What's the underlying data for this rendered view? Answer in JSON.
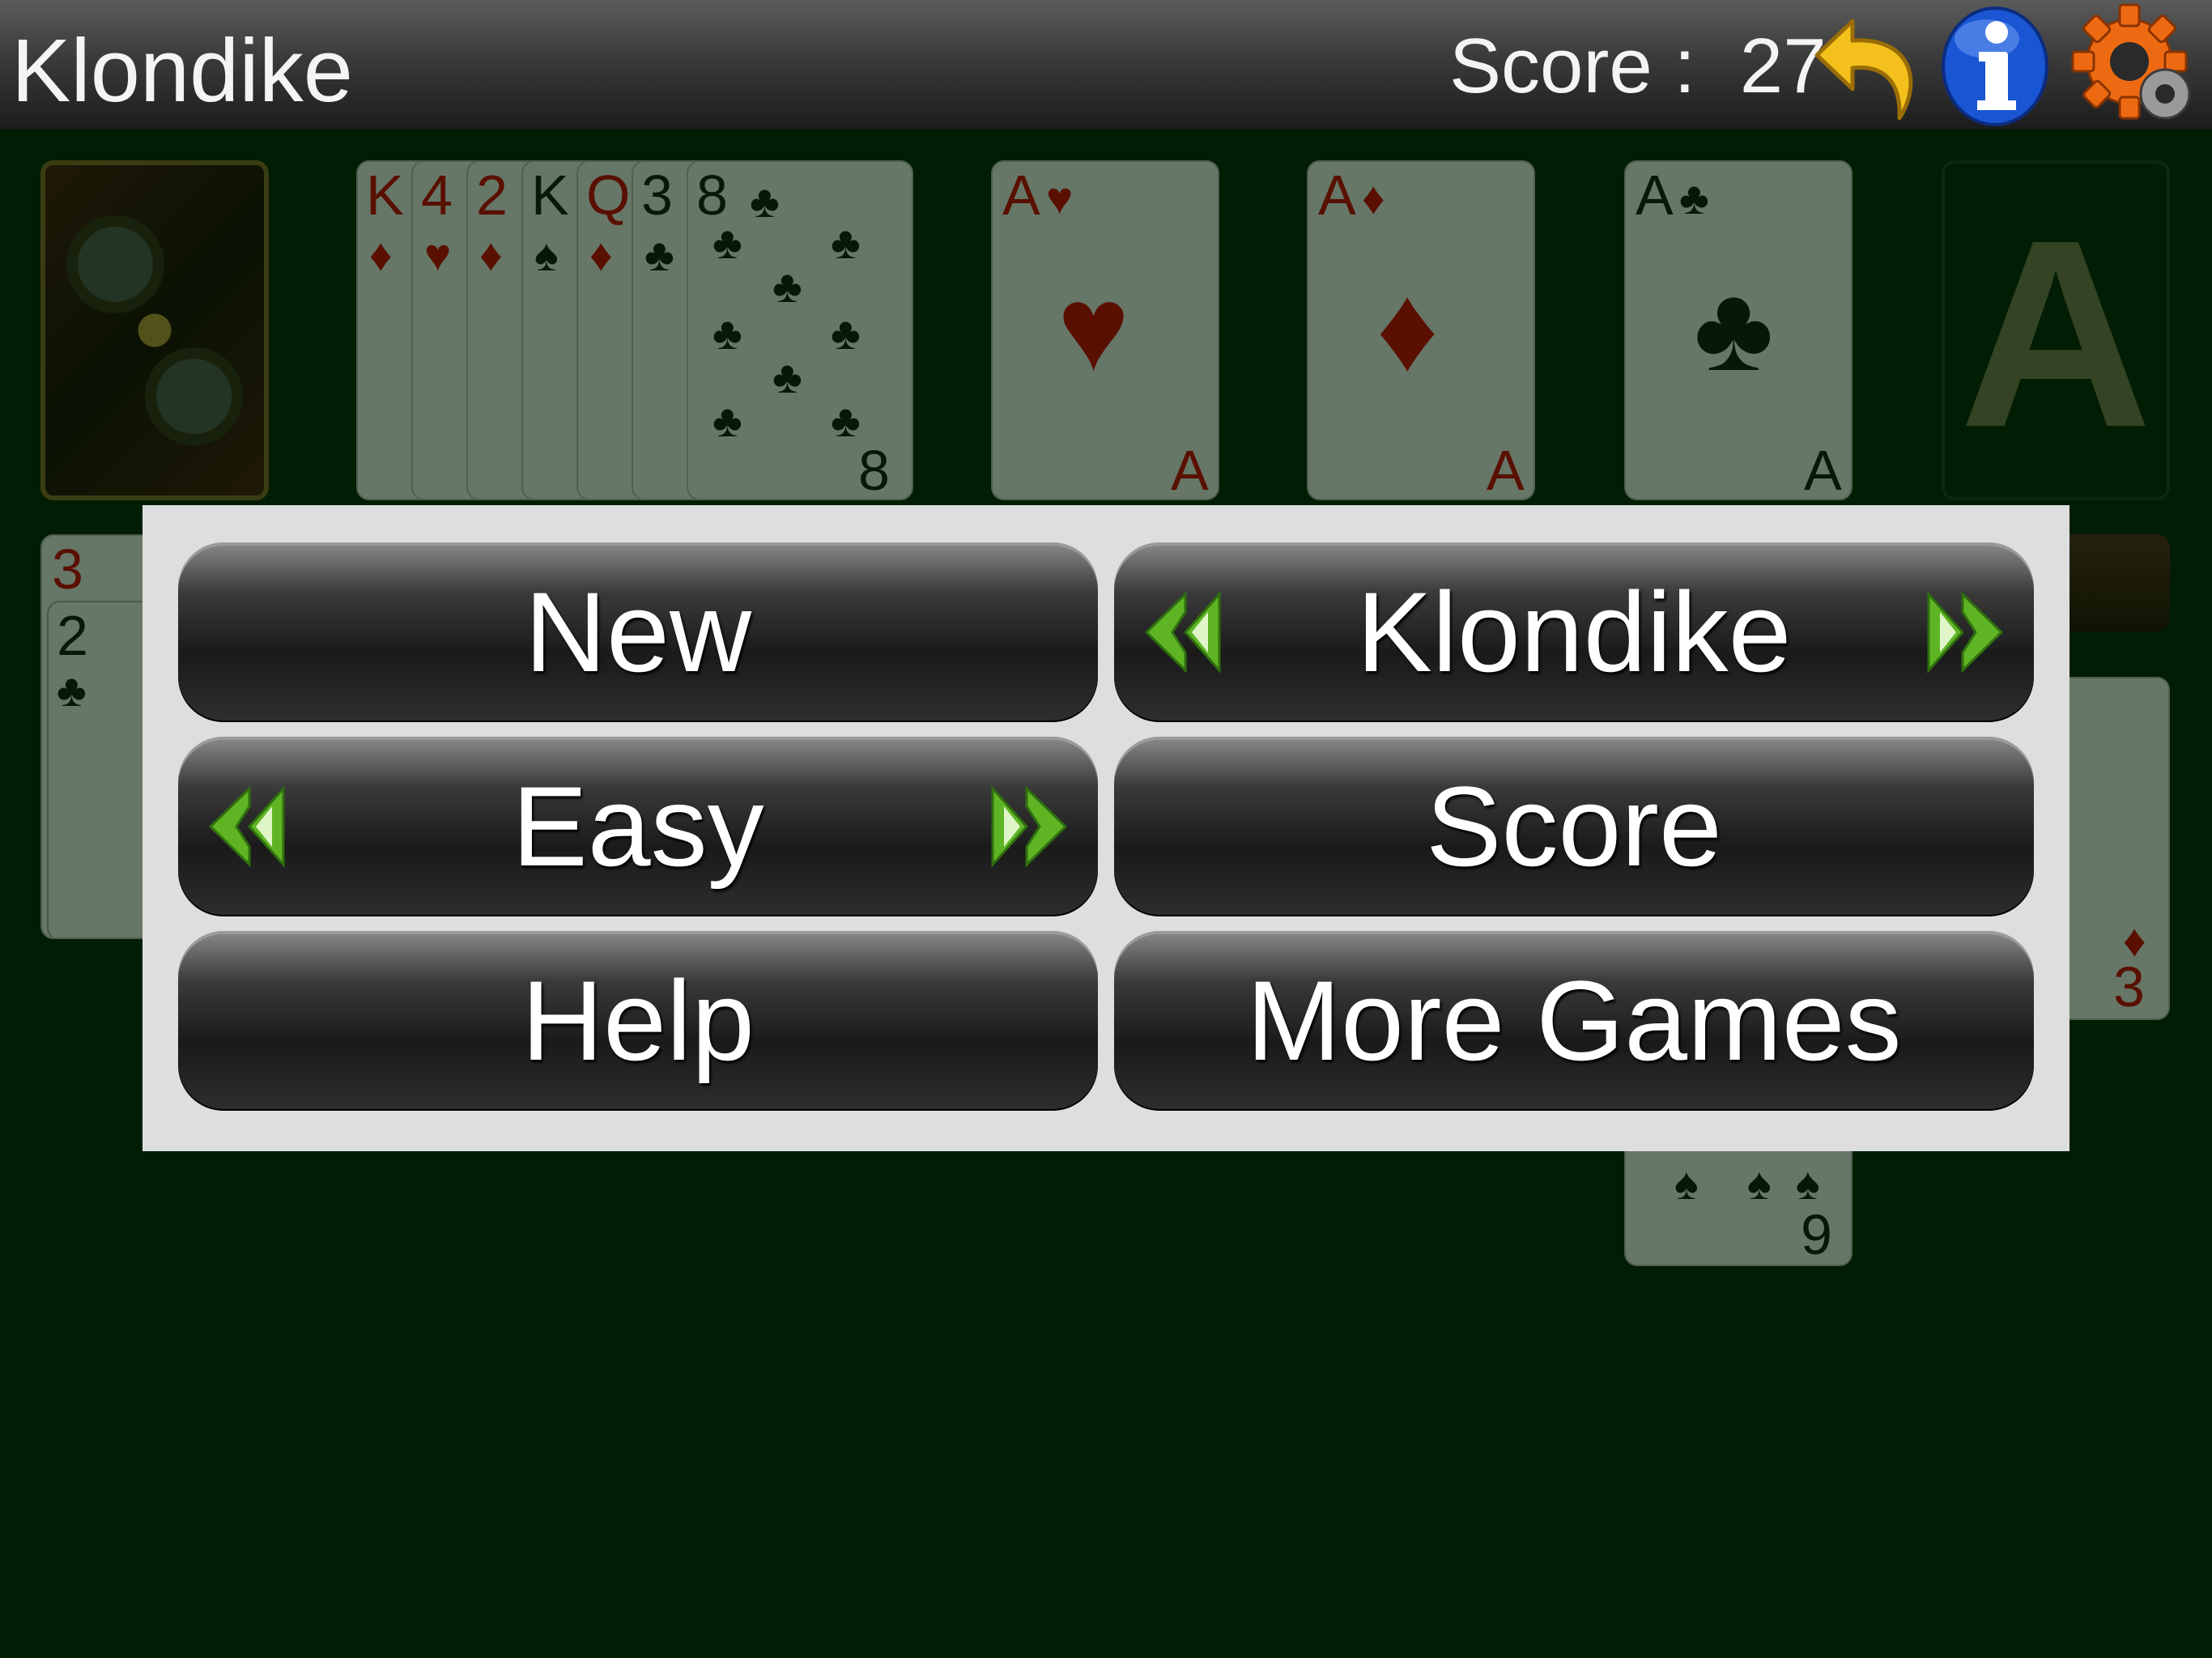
{
  "topbar": {
    "title": "Klondike",
    "score_label": "Score :",
    "score_value": "27",
    "icons": [
      "undo-icon",
      "info-icon",
      "settings-gear-icon"
    ]
  },
  "board": {
    "waste_ranks": [
      "K",
      "4",
      "2",
      "K",
      "Q",
      "3",
      "8"
    ],
    "foundations": [
      {
        "rank": "A",
        "suit": "♥"
      },
      {
        "rank": "A",
        "suit": "♦"
      },
      {
        "rank": "A",
        "suit": "♣"
      }
    ],
    "empty_foundation_label": "A",
    "tableau_visible": [
      "3",
      "2",
      "9",
      "3"
    ]
  },
  "menu": {
    "new_label": "New",
    "game_label": "Klondike",
    "difficulty_label": "Easy",
    "score_label": "Score",
    "help_label": "Help",
    "more_games_label": "More Games"
  },
  "colors": {
    "felt": "#011d03",
    "panel": "#dedede",
    "arrow_green": "#5fb424",
    "info_blue": "#1a55d4",
    "undo_yellow": "#f4c11c",
    "gear_orange": "#ee6a12"
  }
}
